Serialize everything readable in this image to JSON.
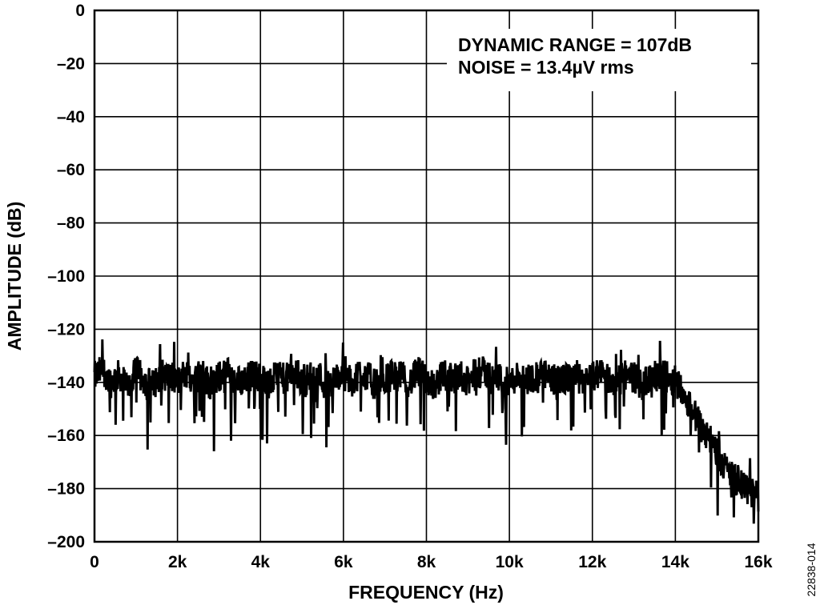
{
  "chart_data": {
    "type": "line",
    "title": "",
    "xlabel": "FREQUENCY (Hz)",
    "ylabel": "AMPLITUDE (dB)",
    "xlim": [
      0,
      16000
    ],
    "ylim": [
      -200,
      0
    ],
    "grid": true,
    "x_ticks": [
      0,
      2000,
      4000,
      6000,
      8000,
      10000,
      12000,
      14000,
      16000
    ],
    "x_tick_labels": [
      "0",
      "2k",
      "4k",
      "6k",
      "8k",
      "10k",
      "12k",
      "14k",
      "16k"
    ],
    "y_ticks": [
      0,
      -20,
      -40,
      -60,
      -80,
      -100,
      -120,
      -140,
      -160,
      -180,
      -200
    ],
    "y_tick_labels": [
      "0",
      "–20",
      "–40",
      "–60",
      "–80",
      "–100",
      "–120",
      "–140",
      "–160",
      "–180",
      "–200"
    ],
    "annotations": [
      "DYNAMIC RANGE = 107dB",
      "NOISE = 13.4µV rms"
    ],
    "series": [
      {
        "color": "#000000",
        "x": [
          0,
          200,
          400,
          600,
          800,
          1000,
          1200,
          1400,
          1600,
          1800,
          2000,
          2200,
          2400,
          2600,
          2800,
          3000,
          3200,
          3400,
          3600,
          3800,
          4000,
          4200,
          4400,
          4600,
          4800,
          5000,
          5200,
          5400,
          5600,
          5800,
          6000,
          6200,
          6400,
          6600,
          6800,
          7000,
          7200,
          7400,
          7600,
          7800,
          8000,
          8200,
          8400,
          8600,
          8800,
          9000,
          9200,
          9400,
          9600,
          9800,
          10000,
          10200,
          10400,
          10600,
          10800,
          11000,
          11200,
          11400,
          11600,
          11800,
          12000,
          12200,
          12400,
          12600,
          12800,
          13000,
          13200,
          13400,
          13600,
          13800,
          14000,
          14200,
          14400,
          14600,
          14800,
          15000,
          15200,
          15400,
          15600,
          15800,
          16000
        ],
        "y": [
          -138,
          -135,
          -140,
          -137,
          -142,
          -136,
          -139,
          -141,
          -137,
          -138,
          -140,
          -136,
          -139,
          -137,
          -141,
          -138,
          -136,
          -140,
          -139,
          -137,
          -138,
          -141,
          -137,
          -139,
          -136,
          -140,
          -138,
          -137,
          -142,
          -139,
          -137,
          -140,
          -136,
          -138,
          -141,
          -139,
          -137,
          -138,
          -140,
          -136,
          -139,
          -141,
          -137,
          -138,
          -139,
          -140,
          -137,
          -136,
          -139,
          -138,
          -141,
          -137,
          -139,
          -138,
          -136,
          -140,
          -138,
          -139,
          -137,
          -141,
          -138,
          -136,
          -139,
          -140,
          -137,
          -138,
          -141,
          -139,
          -137,
          -138,
          -139,
          -144,
          -150,
          -156,
          -160,
          -166,
          -172,
          -176,
          -179,
          -181,
          -183
        ]
      }
    ]
  },
  "figure_id": "22838-014"
}
